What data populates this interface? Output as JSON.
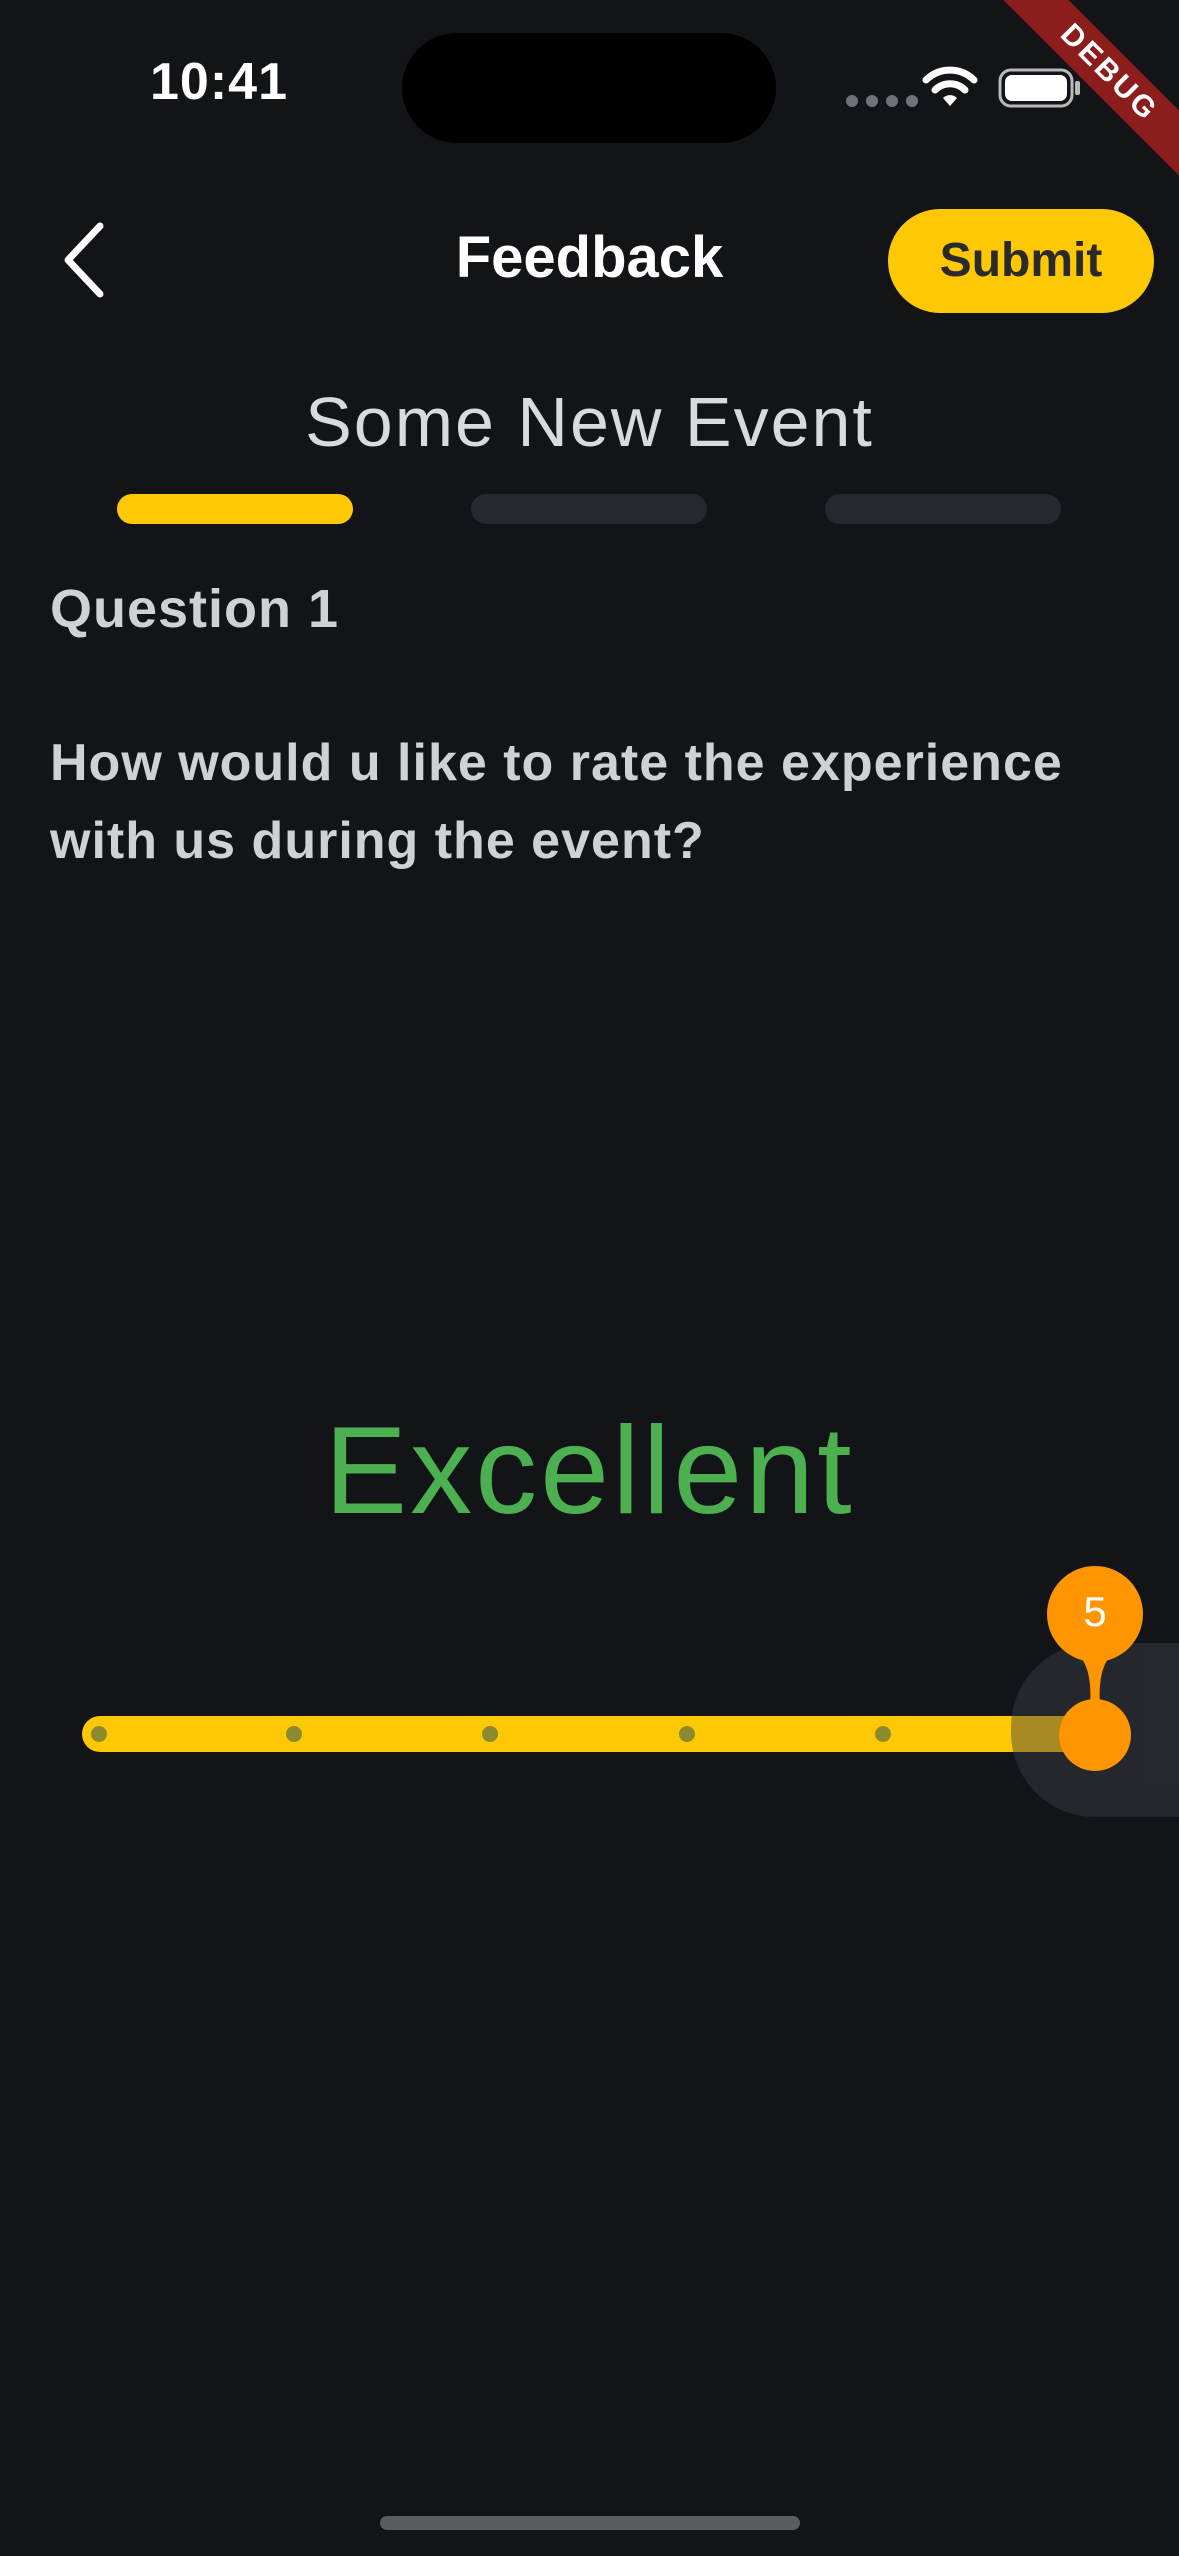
{
  "status_bar": {
    "time": "10:41",
    "icons": [
      "cellular-signal-icon",
      "wifi-icon",
      "battery-icon"
    ]
  },
  "debug_banner": "DEBUG",
  "header": {
    "back_icon": "chevron-left-icon",
    "title": "Feedback",
    "submit_label": "Submit"
  },
  "event": {
    "title": "Some New Event"
  },
  "progress": {
    "total_steps": 3,
    "current_step": 1
  },
  "question": {
    "label": "Question 1",
    "text": "How would u like to rate the experience with us during the event?"
  },
  "rating": {
    "label": "Excellent",
    "value": "5",
    "min": 0,
    "max": 5
  },
  "colors": {
    "background": "#121418",
    "accent": "#ffc804",
    "thumb": "#ff9500",
    "rating_text": "#4caf50",
    "debug_ribbon": "#8c1d1d"
  }
}
